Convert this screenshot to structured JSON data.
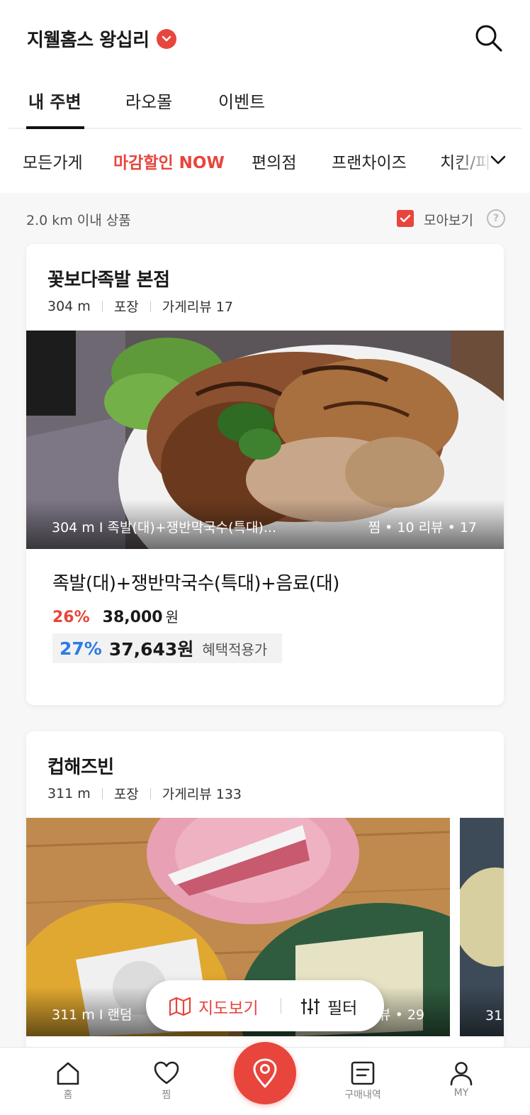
{
  "header": {
    "location": "지웰홈스 왕십리",
    "tabs": [
      "내 주변",
      "라오몰",
      "이벤트"
    ]
  },
  "categories": [
    "모든가게",
    "마감할인 NOW",
    "편의점",
    "프랜차이즈",
    "치킨/피"
  ],
  "filter": {
    "range": "2.0 km 이내 상품",
    "gather_label": "모아보기",
    "gather_checked": true,
    "help": "?"
  },
  "stores": [
    {
      "name": "꽃보다족발 본점",
      "distance": "304 m",
      "type": "포장",
      "review": "가게리뷰 17",
      "photo_caption_left": "304 m  I  족발(대)+쟁반막국수(특대)...",
      "photo_caption_right": "찜 • 10   리뷰 • 17",
      "product": "족발(대)+쟁반막국수(특대)+음료(대)",
      "discount": "26%",
      "price": "38,000",
      "won": "원",
      "benefit_discount": "27%",
      "benefit_price": "37,643원",
      "benefit_label": "혜택적용가"
    },
    {
      "name": "컵해즈빈",
      "distance": "311 m",
      "type": "포장",
      "review": "가게리뷰 133",
      "photo_caption_left": "311 m  I  랜덤",
      "photo_caption_right": "뷰 • 29",
      "next_caption": "31"
    }
  ],
  "floating": {
    "map": "지도보기",
    "filter": "필터"
  },
  "bottom_nav": {
    "home": "홈",
    "favorite": "찜",
    "orders": "구매내역",
    "my": "MY"
  },
  "colors": {
    "accent": "#e8453c",
    "blue": "#2d7be5"
  }
}
